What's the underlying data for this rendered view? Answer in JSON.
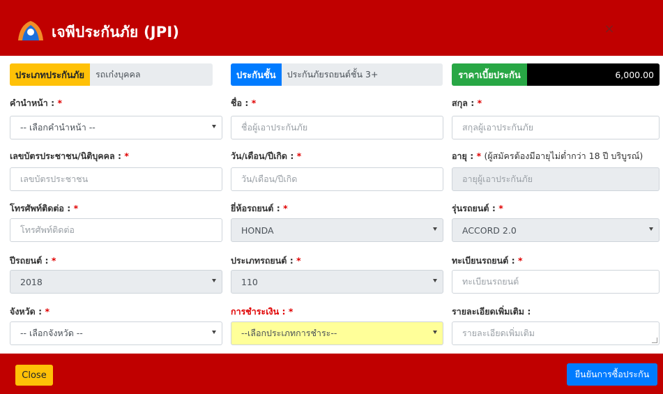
{
  "header": {
    "title": "เจพีประกันภัย (JPI)",
    "close_symbol": "×"
  },
  "summary": {
    "customer_type": {
      "label": "ประเภทประกันภัย",
      "value": "รถเก๋งบุคคล"
    },
    "class": {
      "label": "ประกันชั้น",
      "value": "ประกันภัยรถยนต์ชั้น 3+"
    },
    "premium": {
      "label": "ราคาเบี้ยประกัน",
      "value": "6,000.00"
    }
  },
  "form": {
    "title_prefix": {
      "label": "คำนำหน้า :",
      "value": "-- เลือกคำนำหน้า --"
    },
    "first_name": {
      "label": "ชื่อ :",
      "placeholder": "ชื่อผู้เอาประกันภัย"
    },
    "last_name": {
      "label": "สกุล :",
      "placeholder": "สกุลผู้เอาประกันภัย"
    },
    "id_card": {
      "label": "เลขบัตรประชาชน/นิติบุคคล :",
      "placeholder": "เลขบัตรประชาชน"
    },
    "birthdate": {
      "label": "วัน/เดือน/ปีเกิด :",
      "placeholder": "วัน/เดือน/ปีเกิด"
    },
    "age": {
      "label": "อายุ :",
      "note": "(ผู้สมัครต้องมีอายุไม่ต่ำกว่า 18 ปี บริบูรณ์)",
      "placeholder": "อายุผู้เอาประกันภัย"
    },
    "phone": {
      "label": "โทรศัพท์ติดต่อ :",
      "placeholder": "โทรศัพท์ติดต่อ"
    },
    "car_brand": {
      "label": "ยี่ห้อรถยนต์ :",
      "value": "HONDA"
    },
    "car_model": {
      "label": "รุ่นรถยนต์ :",
      "value": "ACCORD 2.0"
    },
    "car_year": {
      "label": "ปีรถยนต์ :",
      "value": "2018"
    },
    "car_type": {
      "label": "ประเภทรถยนต์ :",
      "value": "110"
    },
    "plate": {
      "label": "ทะเบียนรถยนต์ :",
      "placeholder": "ทะเบียนรถยนต์"
    },
    "province": {
      "label": "จังหวัด :",
      "value": "-- เลือกจังหวัด --"
    },
    "payment": {
      "label": "การชำระเงิน :",
      "value": "--เลือกประเภทการชำระ--"
    },
    "details": {
      "label": "รายละเอียดเพิ่มเติม :",
      "placeholder": "รายละเอียดเพิ่มเติม"
    },
    "required_mark": "*"
  },
  "footer": {
    "close_label": "Close",
    "confirm_label": "ยืนยันการซื้อประกัน"
  },
  "colors": {
    "header_bg": "#c00000",
    "chip_yellow": "#ffc107",
    "chip_blue": "#007bff",
    "chip_green": "#28a745",
    "premium_bg": "#000000",
    "payment_highlight": "#ffff99"
  }
}
